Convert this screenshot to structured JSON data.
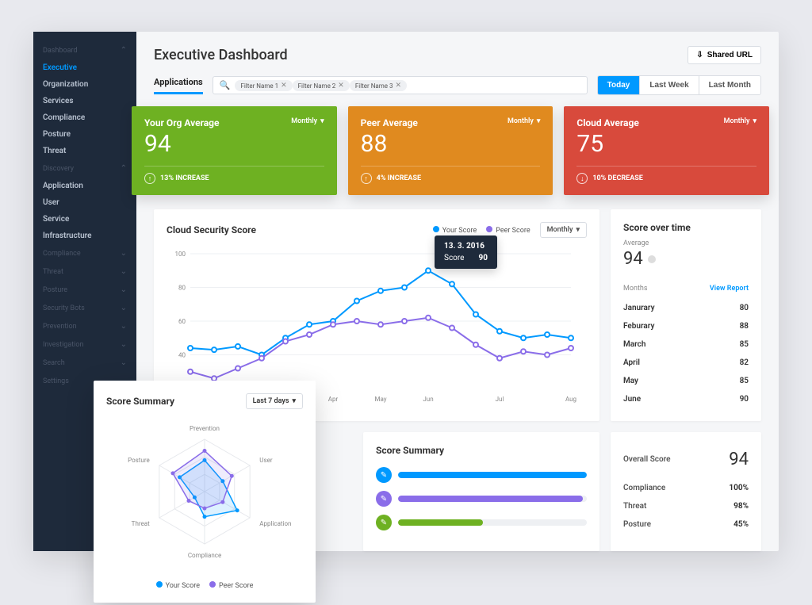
{
  "sidebar": {
    "sections": [
      {
        "title": "Dashboard",
        "expanded": true,
        "items": [
          "Executive",
          "Organization",
          "Services",
          "Compliance",
          "Posture",
          "Threat"
        ],
        "active": "Executive"
      },
      {
        "title": "Discovery",
        "expanded": true,
        "items": [
          "Application",
          "User",
          "Service",
          "Infrastructure"
        ]
      },
      {
        "title": "Compliance",
        "expanded": false
      },
      {
        "title": "Threat",
        "expanded": false
      },
      {
        "title": "Posture",
        "expanded": false
      },
      {
        "title": "Security Bots",
        "expanded": false
      },
      {
        "title": "Prevention",
        "expanded": false
      },
      {
        "title": "Investigation",
        "expanded": false
      },
      {
        "title": "Search",
        "expanded": false
      },
      {
        "title": "Settings",
        "expanded": false
      }
    ]
  },
  "header": {
    "title": "Executive Dashboard",
    "shared_url": "Shared URL"
  },
  "filters": {
    "tab": "Applications",
    "chips": [
      "Filter Name 1",
      "Filter Name 2",
      "Filter Name 3"
    ],
    "ranges": {
      "today": "Today",
      "last_week": "Last Week",
      "last_month": "Last Month"
    }
  },
  "kpis": [
    {
      "title": "Your Org Average",
      "period": "Monthly",
      "value": "94",
      "delta": "13% INCREASE",
      "dir": "up",
      "color": "green"
    },
    {
      "title": "Peer Average",
      "period": "Monthly",
      "value": "88",
      "delta": "4% INCREASE",
      "dir": "up",
      "color": "orange"
    },
    {
      "title": "Cloud Average",
      "period": "Monthly",
      "value": "75",
      "delta": "10% DECREASE",
      "dir": "down",
      "color": "red"
    }
  ],
  "chart_data": {
    "type": "line",
    "title": "Cloud Security Score",
    "ylabel": "",
    "ylim": [
      20,
      100
    ],
    "yticks": [
      40,
      60,
      80,
      100
    ],
    "xticks_visible": [
      "Apr",
      "May",
      "Jun",
      "Jul",
      "Aug"
    ],
    "x": [
      1,
      2,
      3,
      4,
      5,
      6,
      7,
      8,
      9,
      10,
      11,
      12,
      13,
      14,
      15,
      16,
      17
    ],
    "series": [
      {
        "name": "Your Score",
        "color": "#0099ff",
        "values": [
          44,
          43,
          45,
          40,
          50,
          58,
          60,
          72,
          78,
          80,
          90,
          82,
          64,
          54,
          50,
          52,
          50
        ]
      },
      {
        "name": "Peer Score",
        "color": "#8a6de9",
        "values": [
          30,
          26,
          32,
          38,
          48,
          52,
          58,
          60,
          58,
          60,
          62,
          56,
          46,
          38,
          42,
          40,
          44
        ]
      }
    ],
    "tooltip": {
      "date": "13. 3. 2016",
      "label": "Score",
      "value": "90",
      "pointIndex": 10
    },
    "period_dropdown": "Monthly"
  },
  "score_over_time": {
    "title": "Score over time",
    "avg_label": "Average",
    "avg_value": "94",
    "months_label": "Months",
    "view_report": "View Report",
    "rows": [
      {
        "m": "Janurary",
        "v": "80"
      },
      {
        "m": "Feburary",
        "v": "88"
      },
      {
        "m": "March",
        "v": "85"
      },
      {
        "m": "April",
        "v": "82"
      },
      {
        "m": "May",
        "v": "85"
      },
      {
        "m": "June",
        "v": "90"
      }
    ]
  },
  "radar": {
    "title": "Score Summary",
    "dropdown": "Last 7 days",
    "axes": [
      "Prevention",
      "User",
      "Application",
      "Compliance",
      "Threat",
      "Posture"
    ],
    "series": [
      {
        "name": "Your Score",
        "color": "#0099ff",
        "values": [
          60,
          40,
          72,
          48,
          22,
          55
        ]
      },
      {
        "name": "Peer Score",
        "color": "#8a6de9",
        "values": [
          78,
          60,
          40,
          32,
          35,
          70
        ]
      }
    ]
  },
  "score_summary_bars": {
    "title": "Score Summary",
    "bars": [
      {
        "color": "#0099ff",
        "icon": "wrench-icon",
        "pct": 100
      },
      {
        "color": "#8a6de9",
        "icon": "camera-icon",
        "pct": 98
      },
      {
        "color": "#6eb122",
        "icon": "pen-icon",
        "pct": 45
      }
    ]
  },
  "overall": {
    "title_label": "Overall Score",
    "title_value": "94",
    "rows": [
      {
        "l": "Compliance",
        "v": "100%"
      },
      {
        "l": "Threat",
        "v": "98%"
      },
      {
        "l": "Posture",
        "v": "45%"
      }
    ]
  }
}
